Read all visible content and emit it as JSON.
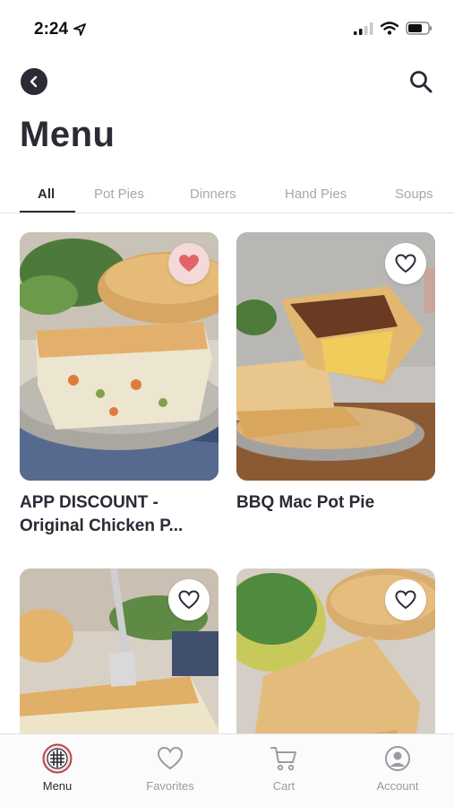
{
  "status_bar": {
    "time": "2:24",
    "icons": [
      "location-arrow-icon",
      "cellular-signal-icon",
      "wifi-icon",
      "battery-icon"
    ]
  },
  "nav": {
    "icons": [
      "back-arrow-icon",
      "search-icon"
    ]
  },
  "page_title": "Menu",
  "tabs": [
    {
      "label": "All",
      "active": true
    },
    {
      "label": "Pot Pies",
      "active": false
    },
    {
      "label": "Dinners",
      "active": false
    },
    {
      "label": "Hand Pies",
      "active": false
    },
    {
      "label": "Soups",
      "active": false
    }
  ],
  "products": [
    {
      "title": "APP DISCOUNT - Original Chicken P...",
      "favorited": true,
      "image": "chicken-pot-pie-photo"
    },
    {
      "title": "BBQ Mac Pot Pie",
      "favorited": false,
      "image": "bbq-mac-pot-pie-photo"
    },
    {
      "title": "",
      "favorited": false,
      "image": "chicken-pie-fork-photo"
    },
    {
      "title": "",
      "favorited": false,
      "image": "hand-pie-salad-photo"
    }
  ],
  "bottom_nav": [
    {
      "label": "Menu",
      "icon": "menu-logo-icon",
      "active": true
    },
    {
      "label": "Favorites",
      "icon": "heart-icon",
      "active": false
    },
    {
      "label": "Cart",
      "icon": "cart-icon",
      "active": false
    },
    {
      "label": "Account",
      "icon": "account-icon",
      "active": false
    }
  ],
  "colors": {
    "primary_text": "#2b2a35",
    "inactive_text": "#a6a6ae",
    "favorite_heart": "#e0656b",
    "favorite_bg": "#f4d9d9"
  }
}
